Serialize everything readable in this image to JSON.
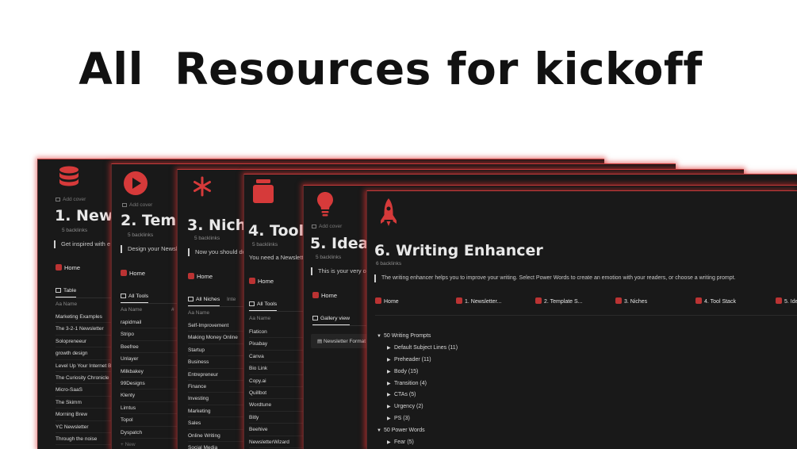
{
  "headline": "All  Resources for kickoff",
  "colors": {
    "accent": "#d63a3a",
    "panel_bg": "#191919",
    "page_bg": "#ffffff"
  },
  "panels": [
    {
      "icon": "database-icon",
      "title": "1. Newsl",
      "backlinks": "5 backlinks",
      "description": "Get inspired with e",
      "home": "Home",
      "view": "Table",
      "column": "Aa Name",
      "items": [
        "Marketing Examples",
        "The 3-2-1 Newsletter",
        "Solopreneeur",
        "growth design",
        "Level Up Your Internet B",
        "The Curiosity Chronicle",
        "Micro-SaaS",
        "The Skimm",
        "Morning Brew",
        "YC Newsletter",
        "Through the noise"
      ]
    },
    {
      "icon": "play-icon",
      "add_cover": "Add cover",
      "title": "2. Templ",
      "backlinks": "5 backlinks",
      "description": "Design your Newsl",
      "home": "Home",
      "view": "All Tools",
      "column": "Aa Name",
      "column_extra": "#",
      "items": [
        "rapidmail",
        "Stripo",
        "Beefree",
        "Unlayer",
        "Milkbakey",
        "99Designs",
        "Klenty",
        "Limtus",
        "Topol",
        "Dyspatch"
      ],
      "new_label": "+ New"
    },
    {
      "icon": "asterisk-icon",
      "title": "3. Niche",
      "backlinks": "5 backlinks",
      "description": "Now you should de",
      "home": "Home",
      "view": "All Niches",
      "view_secondary": "Inte",
      "column": "Aa Name",
      "items": [
        "Self-Improvement",
        "Making Money Online",
        "Startup",
        "Business",
        "Entrepreneur",
        "Finance",
        "Investing",
        "Marketing",
        "Sales",
        "Online Writing",
        "Social Media"
      ]
    },
    {
      "icon": "box-icon",
      "title": "4. Tool S",
      "backlinks": "5 backlinks",
      "description": "You need a Newslett",
      "home": "Home",
      "view": "All Tools",
      "column": "Aa Name",
      "items": [
        "Flaticon",
        "Pixabay",
        "Canva",
        "Bio Link",
        "Copy.ai",
        "Quillbot",
        "Wordtune",
        "Bitly",
        "Beehive",
        "NewsletterWizard"
      ]
    },
    {
      "icon": "lightbulb-icon",
      "add_cover": "Add cover",
      "title": "5. Ideas",
      "backlinks": "5 backlinks",
      "description": "This is your very ov",
      "home": "Home",
      "view": "Gallery view",
      "card": "Newsletter Format"
    },
    {
      "icon": "rocket-icon",
      "title": "6. Writing Enhancer",
      "backlinks": "6 backlinks",
      "description": "The writing enhancer helps you to improve your writing. Select Power Words to create an emotion with your readers, or choose a writing prompt.",
      "nav": [
        "Home",
        "1. Newsletter...",
        "2. Template S...",
        "3. Niches",
        "4. Tool Stack",
        "5. Ide"
      ],
      "tree": [
        {
          "label": "50 Writing Prompts",
          "level": 0,
          "open": true
        },
        {
          "label": "Default Subject Lines (11)",
          "level": 1,
          "open": false
        },
        {
          "label": "Preheader (11)",
          "level": 1,
          "open": false
        },
        {
          "label": "Body (15)",
          "level": 1,
          "open": false
        },
        {
          "label": "Transition (4)",
          "level": 1,
          "open": false
        },
        {
          "label": "CTAs (5)",
          "level": 1,
          "open": false
        },
        {
          "label": "Urgency (2)",
          "level": 1,
          "open": false
        },
        {
          "label": "PS (3)",
          "level": 1,
          "open": false
        },
        {
          "label": "50 Power Words",
          "level": 0,
          "open": true
        },
        {
          "label": "Fear (5)",
          "level": 1,
          "open": false
        }
      ]
    }
  ]
}
